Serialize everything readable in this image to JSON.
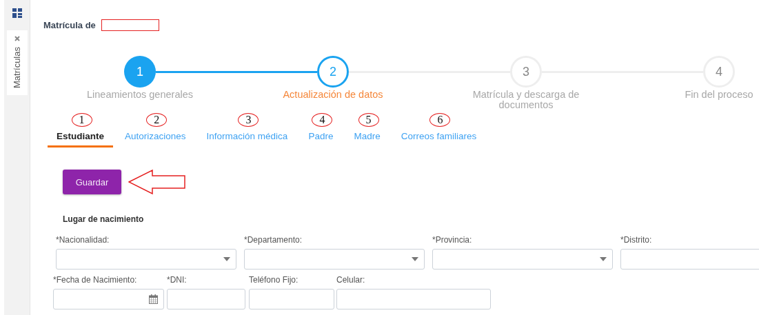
{
  "sidebar_tab": {
    "label": "Matrículas"
  },
  "header": {
    "title": "Matrícula de"
  },
  "steps": [
    {
      "number": "1",
      "label": "Lineamientos generales",
      "completed": true,
      "current": false
    },
    {
      "number": "2",
      "label": "Actualización de datos",
      "completed": false,
      "current": true
    },
    {
      "number": "3",
      "label": "Matrícula y descarga de documentos",
      "completed": false,
      "current": false
    },
    {
      "number": "4",
      "label": "Fin del proceso",
      "completed": false,
      "current": false
    }
  ],
  "tabs": [
    {
      "label": "Estudiante",
      "marker": "1",
      "selected": true
    },
    {
      "label": "Autorizaciones",
      "marker": "2",
      "selected": false
    },
    {
      "label": "Información médica",
      "marker": "3",
      "selected": false
    },
    {
      "label": "Padre",
      "marker": "4",
      "selected": false
    },
    {
      "label": "Madre",
      "marker": "5",
      "selected": false
    },
    {
      "label": "Correos familiares",
      "marker": "6",
      "selected": false
    }
  ],
  "save_button": {
    "label": "Guardar"
  },
  "section": {
    "title": "Lugar de nacimiento"
  },
  "field_rows": [
    [
      {
        "label": "*Nacionalidad:",
        "kind": "select"
      },
      {
        "label": "*Departamento:",
        "kind": "select"
      },
      {
        "label": "*Provincia:",
        "kind": "select"
      },
      {
        "label": "*Distrito:",
        "kind": "text"
      }
    ],
    [
      {
        "label": "*Fecha de Nacimiento:",
        "kind": "date"
      },
      {
        "label": "*DNI:",
        "kind": "text"
      },
      {
        "label": "Teléfono Fijo:",
        "kind": "text"
      },
      {
        "label": "Celular:",
        "kind": "text"
      }
    ]
  ]
}
